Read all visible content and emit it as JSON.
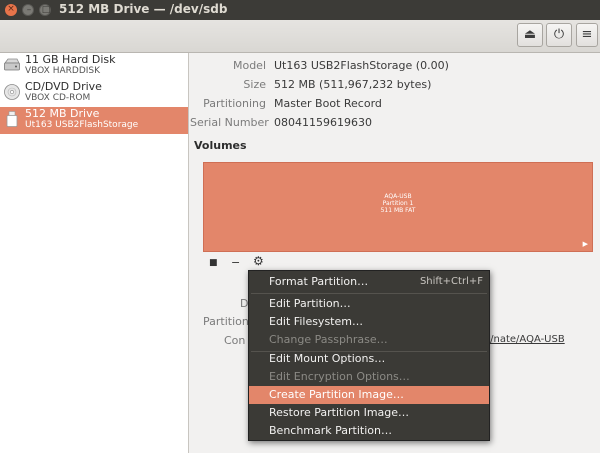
{
  "window": {
    "title": "512 MB Drive — /dev/sdb",
    "close_glyph": "×",
    "min_glyph": "–",
    "max_glyph": "□"
  },
  "header": {
    "eject_glyph": "⏏",
    "power_glyph": "⏻",
    "menu_glyph": "≡"
  },
  "sidebar": {
    "items": [
      {
        "name": "11 GB Hard Disk",
        "sub": "VBOX HARDDISK",
        "icon": "hard-disk-icon"
      },
      {
        "name": "CD/DVD Drive",
        "sub": "VBOX CD-ROM",
        "icon": "optical-disc-icon"
      },
      {
        "name": "512 MB Drive",
        "sub": "Ut163 USB2FlashStorage",
        "icon": "usb-drive-icon"
      }
    ]
  },
  "details": {
    "model_label": "Model",
    "model_value": "Ut163 USB2FlashStorage (0.00)",
    "size_label": "Size",
    "size_value": "512 MB (511,967,232 bytes)",
    "partitioning_label": "Partitioning",
    "partitioning_value": "Master Boot Record",
    "serial_label": "Serial Number",
    "serial_value": "08041159619630"
  },
  "volumes": {
    "heading": "Volumes",
    "line1": "AQA-USB",
    "line2": "Partition 1",
    "line3": "511 MB FAT",
    "play_glyph": "▶",
    "stop_glyph": "■",
    "minus_glyph": "−",
    "gear_glyph": "⚙"
  },
  "partial": {
    "label_d": "D",
    "label_partition": "Partition",
    "label_con": "Con",
    "mount_path": "a/nate/AQA-USB"
  },
  "menu": {
    "items": [
      {
        "label": "Format Partition…",
        "shortcut": "Shift+Ctrl+F",
        "enabled": true
      },
      {
        "label": "Edit Partition…",
        "enabled": true
      },
      {
        "label": "Edit Filesystem…",
        "enabled": true
      },
      {
        "label": "Change Passphrase…",
        "enabled": false
      },
      {
        "label": "Edit Mount Options…",
        "enabled": true
      },
      {
        "label": "Edit Encryption Options…",
        "enabled": false
      },
      {
        "label": "Create Partition Image…",
        "enabled": true,
        "highlighted": true
      },
      {
        "label": "Restore Partition Image…",
        "enabled": true
      },
      {
        "label": "Benchmark Partition…",
        "enabled": true
      }
    ]
  }
}
